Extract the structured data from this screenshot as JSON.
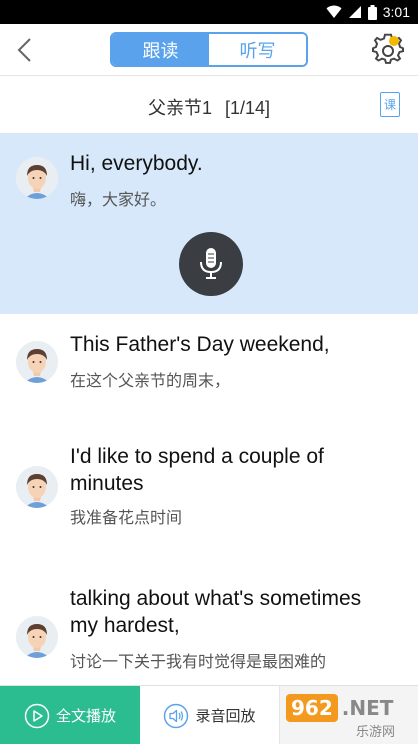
{
  "status_bar": {
    "time": "3:01",
    "icons": [
      "wifi-icon",
      "signal-icon",
      "battery-icon"
    ]
  },
  "nav": {
    "tabs": [
      {
        "label": "跟读",
        "active": true
      },
      {
        "label": "听写",
        "active": false
      }
    ],
    "accent": "#5aa3ec",
    "badge_color": "#f5b800"
  },
  "lesson": {
    "title": "父亲节1",
    "progress": "[1/14]",
    "book_icon_label": "课"
  },
  "sentences": [
    {
      "en": "Hi, everybody.",
      "cn": "嗨，大家好。",
      "active": true
    },
    {
      "en": "This Father's Day weekend,",
      "cn": "在这个父亲节的周末，",
      "active": false
    },
    {
      "en": "I'd like to spend a couple of minutes",
      "cn": "我准备花点时间",
      "active": false
    },
    {
      "en": "talking about what's sometimes my hardest,",
      "cn": "讨论一下关于我有时觉得是最困难的",
      "active": false
    }
  ],
  "bottom": {
    "play_all_label": "全文播放",
    "record_playback_label": "录音回放",
    "play_color": "#2bbd8f",
    "watermark_brand": "962",
    "watermark_net": ".NET",
    "watermark_sub": "乐游网"
  }
}
